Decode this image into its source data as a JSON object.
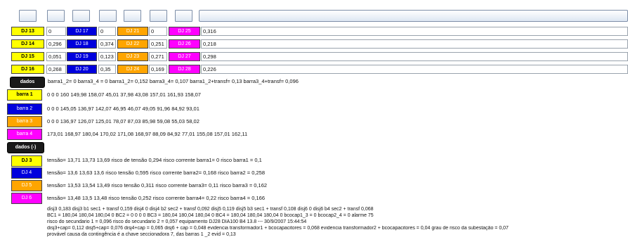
{
  "grid": {
    "rows": [
      {
        "c1_label": "DJ 13",
        "c1_value": "0",
        "c2_label": "DJ 17",
        "c2_value": "0",
        "c3_label": "DJ 21",
        "c3_value": "0",
        "c4_label": "DJ 25",
        "c4_value": "0,316"
      },
      {
        "c1_label": "DJ 14",
        "c1_value": "0,296",
        "c2_label": "DJ 18",
        "c2_value": "0,374",
        "c3_label": "DJ 22",
        "c3_value": "0,251",
        "c4_label": "DJ 26",
        "c4_value": "0,218"
      },
      {
        "c1_label": "DJ 15",
        "c1_value": "0,051",
        "c2_label": "DJ 19",
        "c2_value": "0,123",
        "c3_label": "DJ 23",
        "c3_value": "0,271",
        "c4_label": "DJ 27",
        "c4_value": "0,298"
      },
      {
        "c1_label": "DJ 16",
        "c1_value": "0,268",
        "c2_label": "DJ 20",
        "c2_value": "0,35",
        "c3_label": "DJ 24",
        "c3_value": "0,169",
        "c4_label": "DJ 28",
        "c4_value": "0,226"
      }
    ]
  },
  "dados": {
    "button_label": "dados",
    "summary": "barra1_2= 0 barra3_4 = 0 barra1_2= 0,152 barra3_4= 0,107 barra1_2+transf= 0,13 barra3_4+transf= 0,096"
  },
  "barras": [
    {
      "label": "barra 1",
      "values": "0  0  0  160  149,98  158,07  45,01  37,98  43,08  157,01  161,93  158,07"
    },
    {
      "label": "barra 2",
      "values": "0  0  0  145,05  136,97  142,07  46,95  46,07  49,05  91,96  84,92  93,01"
    },
    {
      "label": "barra 3",
      "values": "0  0  0  136,97  126,07  125,01  78,07  87,03  85,98  59,08  55,03  58,02"
    },
    {
      "label": "barra 4",
      "values": "173,01  168,97  180,04  170,02  171,08  168,97  88,09  84,92  77,01  155,08  157,01  162,11"
    }
  ],
  "dados_minus": {
    "button_label": "dados (-)"
  },
  "djs": [
    {
      "label": "DJ 3",
      "text": "tensão= 13,71  13,73  13,69   risco de tensão  0,294 risco corrente barra1= 0 risco barra1 = 0,1"
    },
    {
      "label": "DJ 4",
      "text": "tensão= 13,6  13,63  13,6   risco tensão  0,595 risco corrente barra2= 0,168 risco barra2 = 0,258"
    },
    {
      "label": "DJ 5",
      "text": "tensão= 13,53  13,54  13,49   risco tensão 0,311 risco corrente barra3= 0,11 risco barra3 = 0,162"
    },
    {
      "label": "DJ 6",
      "text": "tensão= 13,48  13,5  13,48   risco tensão 0,252 risco corrente barra4= 0,22 risco barra4 = 0,166"
    }
  ],
  "footer": [
    "disj3 0,183 disj3 b1 sec1 + transf  0,159 disj4 0 disj4 b2 sec2 + transf  0,092  disj5 0,119 disj5 b3 sec1 + transf  0,108 disj6 0 disj6 b4 sec2 + transf  0,068",
    "BC1 = 180,04  180,04  180,04   0  BC2 =   0  0  0  0  BC3 =  180,04  180,04  180,04   0  BC4 =  180,04   180,04  180,04  0  bcocap1_3 = 0 bcocap2_4 = 0 alarme 75",
    "risco do secundario 1 = 0,096   risco do secundario 2 = 0,057      equipamento    DJ28 DIA100 B4 13.8    ---    30/9/2007 15:44:54",
    "disj3+cap= 0,112 disj5+cap= 0,076 disj4+cap = 0,065 disj6 + cap = 0,048  evidencia transformador1 + bcocapacitores = 0,068  evidencia transformador2 + bcocapacitores =  0,04   grau de risco da subestação = 0,07",
    "provável causa da contingência é a chave seccionadora 7, das barras 1 _2  evid = 0,13"
  ]
}
